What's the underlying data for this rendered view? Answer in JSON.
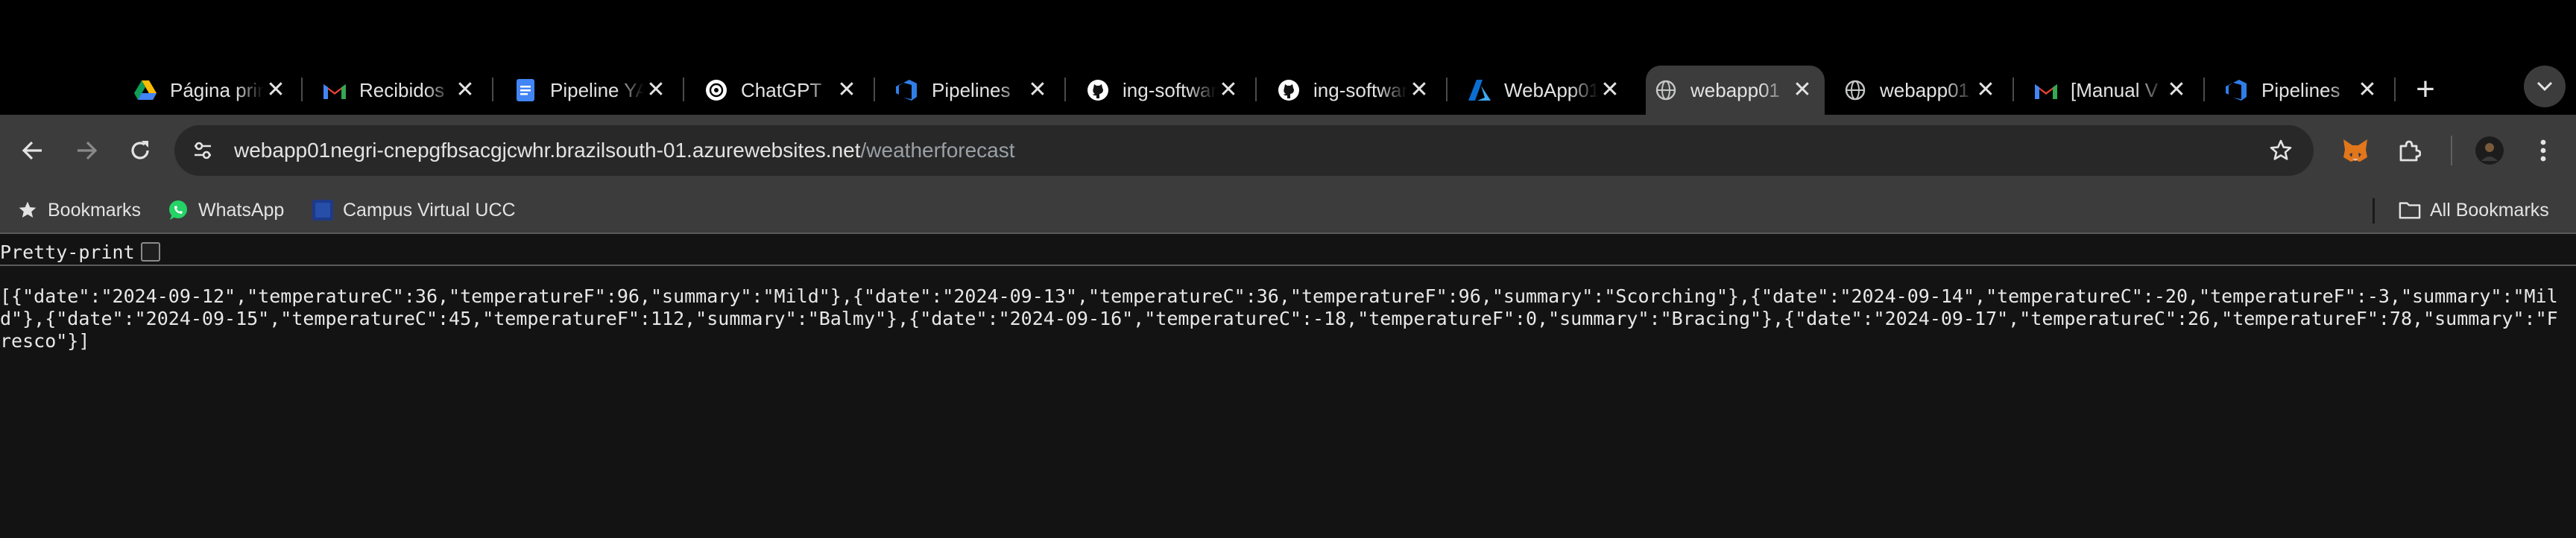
{
  "tabs": [
    {
      "title": "Página principal",
      "icon": "google-drive-icon"
    },
    {
      "title": "Recibidos",
      "icon": "gmail-icon"
    },
    {
      "title": "Pipeline YAML",
      "icon": "google-docs-icon"
    },
    {
      "title": "ChatGPT",
      "icon": "chatgpt-icon"
    },
    {
      "title": "Pipelines",
      "icon": "azure-devops-icon"
    },
    {
      "title": "ing-software",
      "icon": "github-icon"
    },
    {
      "title": "ing-software",
      "icon": "github-icon"
    },
    {
      "title": "WebApp01",
      "icon": "azure-icon"
    },
    {
      "title": "webapp01",
      "icon": "globe-icon",
      "active": true
    },
    {
      "title": "webapp01",
      "icon": "globe-icon"
    },
    {
      "title": "[Manual V",
      "icon": "gmail-icon"
    },
    {
      "title": "Pipelines",
      "icon": "azure-devops-icon"
    }
  ],
  "address_bar": {
    "host": "webapp01negri-cnepgfbsacgjcwhr.brazilsouth-01.azurewebsites.net",
    "path": "/weatherforecast"
  },
  "bookmarks_bar": {
    "items": [
      {
        "label": "Bookmarks",
        "icon": "star-icon"
      },
      {
        "label": "WhatsApp",
        "icon": "whatsapp-icon"
      },
      {
        "label": "Campus Virtual UCC",
        "icon": "campus-icon"
      }
    ],
    "all_bookmarks": "All Bookmarks"
  },
  "pretty_print": {
    "label": "Pretty-print",
    "checked": false
  },
  "json_body": "[{\"date\":\"2024-09-12\",\"temperatureC\":36,\"temperatureF\":96,\"summary\":\"Mild\"},{\"date\":\"2024-09-13\",\"temperatureC\":36,\"temperatureF\":96,\"summary\":\"Scorching\"},{\"date\":\"2024-09-14\",\"temperatureC\":-20,\"temperatureF\":-3,\"summary\":\"Mild\"},{\"date\":\"2024-09-15\",\"temperatureC\":45,\"temperatureF\":112,\"summary\":\"Balmy\"},{\"date\":\"2024-09-16\",\"temperatureC\":-18,\"temperatureF\":0,\"summary\":\"Bracing\"},{\"date\":\"2024-09-17\",\"temperatureC\":26,\"temperatureF\":78,\"summary\":\"Fresco\"}]",
  "colors": {
    "tabstrip": "#000000",
    "toolbar": "#3c3c3c",
    "omnibox": "#282828",
    "page_background": "#131313",
    "url_path": "#9aa0a6"
  }
}
